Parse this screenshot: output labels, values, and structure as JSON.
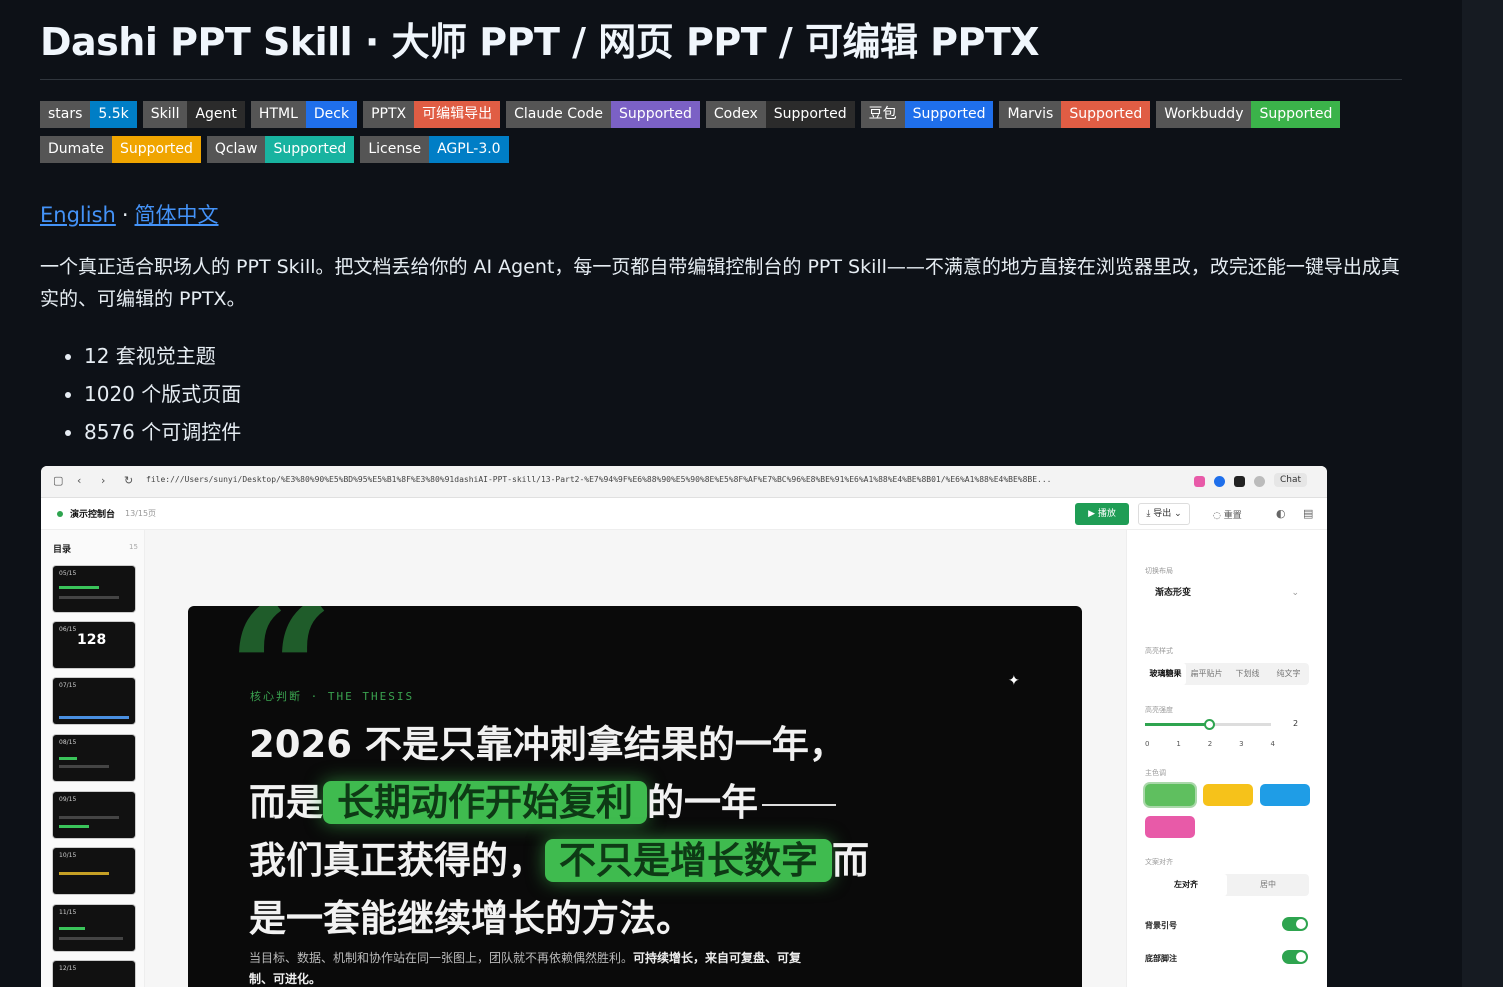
{
  "title": "Dashi PPT Skill · 大师 PPT / 网页 PPT / 可编辑 PPTX",
  "badges": [
    {
      "label": "stars",
      "value": "5.5k",
      "color": "#007ec6"
    },
    {
      "label": "Skill",
      "value": "Agent",
      "color": "#2b2b2b"
    },
    {
      "label": "HTML",
      "value": "Deck",
      "color": "#1f6feb"
    },
    {
      "label": "PPTX",
      "value": "可编辑导出",
      "color": "#e05d44"
    },
    {
      "label": "Claude Code",
      "value": "Supported",
      "color": "#7b61c5"
    },
    {
      "label": "Codex",
      "value": "Supported",
      "color": "#2b2b2b"
    },
    {
      "label": "豆包",
      "value": "Supported",
      "color": "#1f6feb"
    },
    {
      "label": "Marvis",
      "value": "Supported",
      "color": "#e05d44"
    },
    {
      "label": "Workbuddy",
      "value": "Supported",
      "color": "#3bb34a"
    },
    {
      "label": "Dumate",
      "value": "Supported",
      "color": "#f0a500"
    },
    {
      "label": "Qclaw",
      "value": "Supported",
      "color": "#18b3a0"
    },
    {
      "label": "License",
      "value": "AGPL-3.0",
      "color": "#007ec6"
    }
  ],
  "lang": {
    "english": "English",
    "separator": "·",
    "chinese": "简体中文"
  },
  "description": "一个真正适合职场人的 PPT Skill。把文档丢给你的 AI Agent，每一页都自带编辑控制台的 PPT Skill——不满意的地方直接在浏览器里改，改完还能一键导出成真实的、可编辑的 PPTX。",
  "features": [
    "12 套视觉主题",
    "1020 个版式页面",
    "8576 个可调控件"
  ],
  "screenshot": {
    "url": "file:///Users/sunyi/Desktop/%E3%80%90%E5%BD%95%E5%B1%8F%E3%80%91dashiAI-PPT-skill/13-Part2-%E7%94%9F%E6%88%90%E5%90%8E%E5%8F%AF%E7%BC%96%E8%BE%91%E6%A1%88%E4%BE%8B01/%E6%A1%88%E4%BE%8BE...",
    "chat_label": "Chat",
    "toolbar": {
      "name": "演示控制台",
      "count": "13/15页",
      "play": "▶ 播放",
      "export": "⤓ 导出 ⌄",
      "reset": "◌ 重置"
    },
    "thumbs": {
      "header": "目录",
      "count": "15",
      "items": [
        "05/15",
        "06/15",
        "07/15",
        "08/15",
        "09/15",
        "10/15",
        "11/15",
        "12/15"
      ],
      "big_number": "128"
    },
    "slide": {
      "kicker": "核心判断 · THE THESIS",
      "line1": "2026 不是只靠冲刺拿结果的一年，",
      "line2_pre": "而是",
      "line2_hl": "长期动作开始复利",
      "line2_post": "的一年",
      "line3_pre": "我们真正获得的，",
      "line3_hl": "不只是增长数字",
      "line3_post": "而",
      "line4": "是一套能继续增长的方法。",
      "sub_plain": "当目标、数据、机制和协作站在同一张图上，团队就不再依赖偶然胜利。",
      "sub_bold": "可持续增长，来自可复盘、可复制、可进化。"
    },
    "panel": {
      "label1": "切换布局",
      "select": "渐态形变",
      "label2": "高亮样式",
      "seg1": [
        "玻璃糖果",
        "扁平贴片",
        "下划线",
        "纯文字"
      ],
      "label3": "高亮强度",
      "slider_value": "2",
      "ticks": [
        "0",
        "1",
        "2",
        "3",
        "4"
      ],
      "label4": "主色调",
      "swatches": [
        "#5fbf5f",
        "#f6c21a",
        "#1f9de6",
        "#e85aa8"
      ],
      "label5": "文案对齐",
      "seg2": [
        "左对齐",
        "居中"
      ],
      "opt1": "背景引号",
      "opt2": "底部脚注"
    }
  }
}
